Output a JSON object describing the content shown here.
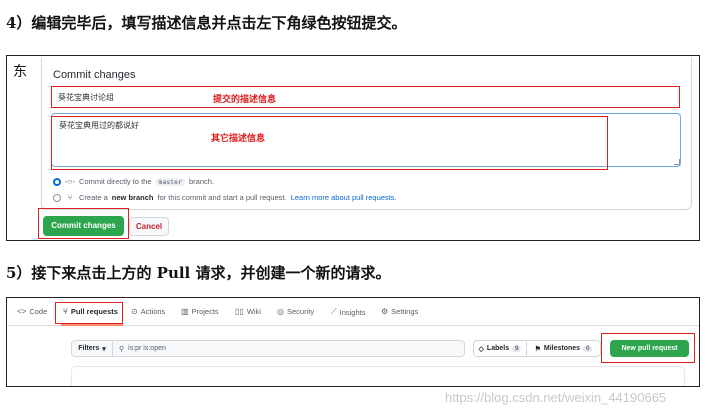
{
  "steps": {
    "step4": "4）编辑完毕后，填写描述信息并点击左下角绿色按钮提交。",
    "step5_prefix": "5）接下来点击上方的 ",
    "step5_bold": "Pull",
    "step5_suffix": " 请求，并创建一个新的请求。"
  },
  "commit_panel": {
    "side_char": "东",
    "title": "Commit changes",
    "summary_value": "葵花宝典讨论组",
    "summary_annotation": "提交的描述信息",
    "description_value": "葵花宝典用过的都说好",
    "description_annotation": "其它描述信息",
    "radio_direct": {
      "text_before": "Commit directly to the",
      "branch": "master",
      "text_after": "branch."
    },
    "radio_new": {
      "text_before": "Create a",
      "bold": "new branch",
      "text_after": "for this commit and start a pull request.",
      "link": "Learn more about pull requests."
    },
    "commit_button": "Commit changes",
    "cancel_button": "Cancel"
  },
  "repo_panel": {
    "tabs": {
      "code": "Code",
      "pull_requests": "Pull requests",
      "actions": "Actions",
      "projects": "Projects",
      "wiki": "Wiki",
      "security": "Security",
      "insights": "Insights",
      "settings": "Settings"
    },
    "filters_label": "Filters",
    "search_value": "is:pr is:open",
    "labels_label": "Labels",
    "labels_count": "9",
    "milestones_label": "Milestones",
    "milestones_count": "0",
    "new_pr_button": "New pull request"
  },
  "watermark": "https://blog.csdn.net/weixin_44190665",
  "colors": {
    "annotation_red": "#e02020",
    "primary_green": "#2da44e",
    "link_blue": "#0969da"
  }
}
